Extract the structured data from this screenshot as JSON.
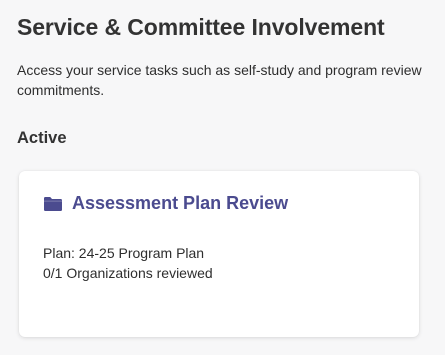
{
  "page": {
    "title": "Service & Committee Involvement",
    "description": "Access your service tasks such as self-study and program review commitments."
  },
  "section": {
    "heading": "Active"
  },
  "card": {
    "icon": "folder-icon",
    "title": "Assessment Plan Review",
    "plan_line": "Plan: 24-25 Program Plan",
    "progress_line": "0/1 Organizations reviewed"
  },
  "colors": {
    "background": "#f7f7f8",
    "card_title": "#4b4b8f",
    "folder_icon": "#4b4b8f"
  }
}
